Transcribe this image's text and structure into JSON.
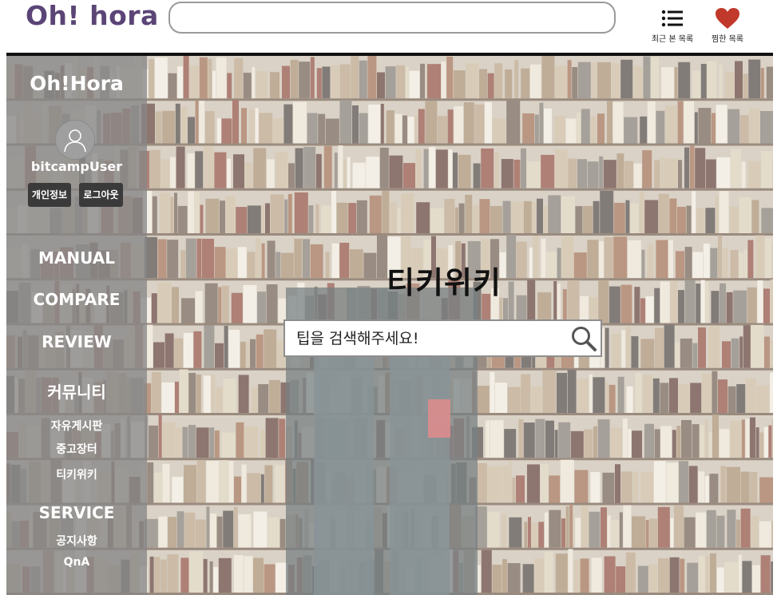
{
  "header": {
    "logo": "Oh! hora",
    "search_value": "",
    "recent_label": "최근 본 목록",
    "wish_label": "찜한 목록",
    "recent_icon": "list-icon",
    "wish_icon": "heart-icon"
  },
  "sidebar": {
    "title": "Oh!Hora",
    "avatar_icon": "user-icon",
    "username": "bitcampUser",
    "profile_button": "개인정보",
    "logout_button": "로그아웃",
    "items": [
      {
        "label": "MANUAL"
      },
      {
        "label": "COMPARE"
      },
      {
        "label": "REVIEW"
      },
      {
        "label": "커뮤니티"
      },
      {
        "label": "자유게시판"
      },
      {
        "label": "중고장터"
      },
      {
        "label": "티키위키"
      },
      {
        "label": "SERVICE"
      },
      {
        "label": "공지사항"
      },
      {
        "label": "QnA"
      }
    ]
  },
  "main": {
    "title": "티키위키",
    "search_placeholder": "팁을 검색해주세요!",
    "search_icon": "search-icon",
    "background": "bookshelf-image"
  },
  "colors": {
    "logo": "#5b4577",
    "wish_heart": "#c0392b",
    "sidebar_bg": "#878787",
    "button_bg": "#3a3a3a"
  }
}
